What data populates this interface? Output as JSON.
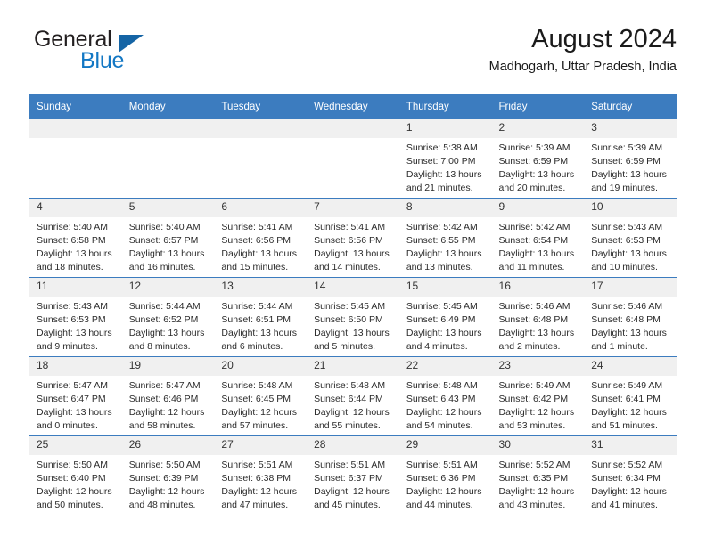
{
  "brand": {
    "line1": "General",
    "line2": "Blue",
    "triangle_color": "#1464a5",
    "blue_color": "#1277c4"
  },
  "header": {
    "title": "August 2024",
    "subtitle": "Madhogarh, Uttar Pradesh, India"
  },
  "theme": {
    "header_bg": "#3c7cbf",
    "header_text": "#ffffff",
    "daynum_bg": "#f0f0f0",
    "grid_line": "#3c7cbf"
  },
  "weekday_headers": [
    "Sunday",
    "Monday",
    "Tuesday",
    "Wednesday",
    "Thursday",
    "Friday",
    "Saturday"
  ],
  "weeks": [
    [
      {
        "day": "",
        "empty": true,
        "sunrise": "",
        "sunset": "",
        "daylight_line1": "",
        "daylight_line2": ""
      },
      {
        "day": "",
        "empty": true,
        "sunrise": "",
        "sunset": "",
        "daylight_line1": "",
        "daylight_line2": ""
      },
      {
        "day": "",
        "empty": true,
        "sunrise": "",
        "sunset": "",
        "daylight_line1": "",
        "daylight_line2": ""
      },
      {
        "day": "",
        "empty": true,
        "sunrise": "",
        "sunset": "",
        "daylight_line1": "",
        "daylight_line2": ""
      },
      {
        "day": "1",
        "empty": false,
        "sunrise": "Sunrise: 5:38 AM",
        "sunset": "Sunset: 7:00 PM",
        "daylight_line1": "Daylight: 13 hours",
        "daylight_line2": "and 21 minutes."
      },
      {
        "day": "2",
        "empty": false,
        "sunrise": "Sunrise: 5:39 AM",
        "sunset": "Sunset: 6:59 PM",
        "daylight_line1": "Daylight: 13 hours",
        "daylight_line2": "and 20 minutes."
      },
      {
        "day": "3",
        "empty": false,
        "sunrise": "Sunrise: 5:39 AM",
        "sunset": "Sunset: 6:59 PM",
        "daylight_line1": "Daylight: 13 hours",
        "daylight_line2": "and 19 minutes."
      }
    ],
    [
      {
        "day": "4",
        "empty": false,
        "sunrise": "Sunrise: 5:40 AM",
        "sunset": "Sunset: 6:58 PM",
        "daylight_line1": "Daylight: 13 hours",
        "daylight_line2": "and 18 minutes."
      },
      {
        "day": "5",
        "empty": false,
        "sunrise": "Sunrise: 5:40 AM",
        "sunset": "Sunset: 6:57 PM",
        "daylight_line1": "Daylight: 13 hours",
        "daylight_line2": "and 16 minutes."
      },
      {
        "day": "6",
        "empty": false,
        "sunrise": "Sunrise: 5:41 AM",
        "sunset": "Sunset: 6:56 PM",
        "daylight_line1": "Daylight: 13 hours",
        "daylight_line2": "and 15 minutes."
      },
      {
        "day": "7",
        "empty": false,
        "sunrise": "Sunrise: 5:41 AM",
        "sunset": "Sunset: 6:56 PM",
        "daylight_line1": "Daylight: 13 hours",
        "daylight_line2": "and 14 minutes."
      },
      {
        "day": "8",
        "empty": false,
        "sunrise": "Sunrise: 5:42 AM",
        "sunset": "Sunset: 6:55 PM",
        "daylight_line1": "Daylight: 13 hours",
        "daylight_line2": "and 13 minutes."
      },
      {
        "day": "9",
        "empty": false,
        "sunrise": "Sunrise: 5:42 AM",
        "sunset": "Sunset: 6:54 PM",
        "daylight_line1": "Daylight: 13 hours",
        "daylight_line2": "and 11 minutes."
      },
      {
        "day": "10",
        "empty": false,
        "sunrise": "Sunrise: 5:43 AM",
        "sunset": "Sunset: 6:53 PM",
        "daylight_line1": "Daylight: 13 hours",
        "daylight_line2": "and 10 minutes."
      }
    ],
    [
      {
        "day": "11",
        "empty": false,
        "sunrise": "Sunrise: 5:43 AM",
        "sunset": "Sunset: 6:53 PM",
        "daylight_line1": "Daylight: 13 hours",
        "daylight_line2": "and 9 minutes."
      },
      {
        "day": "12",
        "empty": false,
        "sunrise": "Sunrise: 5:44 AM",
        "sunset": "Sunset: 6:52 PM",
        "daylight_line1": "Daylight: 13 hours",
        "daylight_line2": "and 8 minutes."
      },
      {
        "day": "13",
        "empty": false,
        "sunrise": "Sunrise: 5:44 AM",
        "sunset": "Sunset: 6:51 PM",
        "daylight_line1": "Daylight: 13 hours",
        "daylight_line2": "and 6 minutes."
      },
      {
        "day": "14",
        "empty": false,
        "sunrise": "Sunrise: 5:45 AM",
        "sunset": "Sunset: 6:50 PM",
        "daylight_line1": "Daylight: 13 hours",
        "daylight_line2": "and 5 minutes."
      },
      {
        "day": "15",
        "empty": false,
        "sunrise": "Sunrise: 5:45 AM",
        "sunset": "Sunset: 6:49 PM",
        "daylight_line1": "Daylight: 13 hours",
        "daylight_line2": "and 4 minutes."
      },
      {
        "day": "16",
        "empty": false,
        "sunrise": "Sunrise: 5:46 AM",
        "sunset": "Sunset: 6:48 PM",
        "daylight_line1": "Daylight: 13 hours",
        "daylight_line2": "and 2 minutes."
      },
      {
        "day": "17",
        "empty": false,
        "sunrise": "Sunrise: 5:46 AM",
        "sunset": "Sunset: 6:48 PM",
        "daylight_line1": "Daylight: 13 hours",
        "daylight_line2": "and 1 minute."
      }
    ],
    [
      {
        "day": "18",
        "empty": false,
        "sunrise": "Sunrise: 5:47 AM",
        "sunset": "Sunset: 6:47 PM",
        "daylight_line1": "Daylight: 13 hours",
        "daylight_line2": "and 0 minutes."
      },
      {
        "day": "19",
        "empty": false,
        "sunrise": "Sunrise: 5:47 AM",
        "sunset": "Sunset: 6:46 PM",
        "daylight_line1": "Daylight: 12 hours",
        "daylight_line2": "and 58 minutes."
      },
      {
        "day": "20",
        "empty": false,
        "sunrise": "Sunrise: 5:48 AM",
        "sunset": "Sunset: 6:45 PM",
        "daylight_line1": "Daylight: 12 hours",
        "daylight_line2": "and 57 minutes."
      },
      {
        "day": "21",
        "empty": false,
        "sunrise": "Sunrise: 5:48 AM",
        "sunset": "Sunset: 6:44 PM",
        "daylight_line1": "Daylight: 12 hours",
        "daylight_line2": "and 55 minutes."
      },
      {
        "day": "22",
        "empty": false,
        "sunrise": "Sunrise: 5:48 AM",
        "sunset": "Sunset: 6:43 PM",
        "daylight_line1": "Daylight: 12 hours",
        "daylight_line2": "and 54 minutes."
      },
      {
        "day": "23",
        "empty": false,
        "sunrise": "Sunrise: 5:49 AM",
        "sunset": "Sunset: 6:42 PM",
        "daylight_line1": "Daylight: 12 hours",
        "daylight_line2": "and 53 minutes."
      },
      {
        "day": "24",
        "empty": false,
        "sunrise": "Sunrise: 5:49 AM",
        "sunset": "Sunset: 6:41 PM",
        "daylight_line1": "Daylight: 12 hours",
        "daylight_line2": "and 51 minutes."
      }
    ],
    [
      {
        "day": "25",
        "empty": false,
        "sunrise": "Sunrise: 5:50 AM",
        "sunset": "Sunset: 6:40 PM",
        "daylight_line1": "Daylight: 12 hours",
        "daylight_line2": "and 50 minutes."
      },
      {
        "day": "26",
        "empty": false,
        "sunrise": "Sunrise: 5:50 AM",
        "sunset": "Sunset: 6:39 PM",
        "daylight_line1": "Daylight: 12 hours",
        "daylight_line2": "and 48 minutes."
      },
      {
        "day": "27",
        "empty": false,
        "sunrise": "Sunrise: 5:51 AM",
        "sunset": "Sunset: 6:38 PM",
        "daylight_line1": "Daylight: 12 hours",
        "daylight_line2": "and 47 minutes."
      },
      {
        "day": "28",
        "empty": false,
        "sunrise": "Sunrise: 5:51 AM",
        "sunset": "Sunset: 6:37 PM",
        "daylight_line1": "Daylight: 12 hours",
        "daylight_line2": "and 45 minutes."
      },
      {
        "day": "29",
        "empty": false,
        "sunrise": "Sunrise: 5:51 AM",
        "sunset": "Sunset: 6:36 PM",
        "daylight_line1": "Daylight: 12 hours",
        "daylight_line2": "and 44 minutes."
      },
      {
        "day": "30",
        "empty": false,
        "sunrise": "Sunrise: 5:52 AM",
        "sunset": "Sunset: 6:35 PM",
        "daylight_line1": "Daylight: 12 hours",
        "daylight_line2": "and 43 minutes."
      },
      {
        "day": "31",
        "empty": false,
        "sunrise": "Sunrise: 5:52 AM",
        "sunset": "Sunset: 6:34 PM",
        "daylight_line1": "Daylight: 12 hours",
        "daylight_line2": "and 41 minutes."
      }
    ]
  ]
}
